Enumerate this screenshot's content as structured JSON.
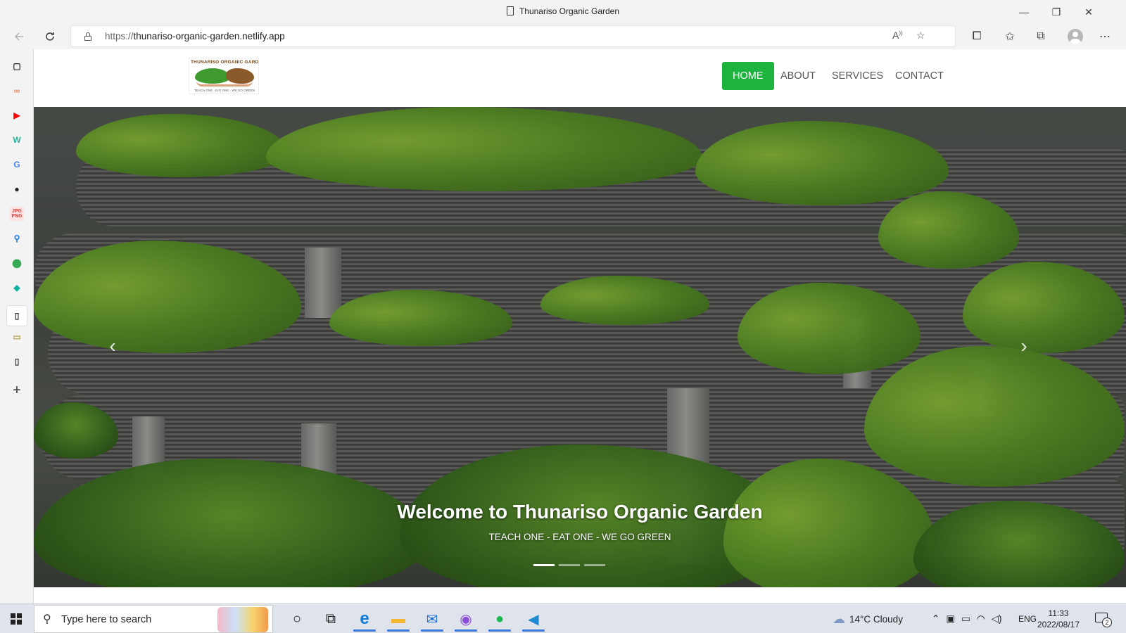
{
  "window": {
    "title": "Thunariso Organic Garden",
    "controls": {
      "minimize": "—",
      "restore": "❐",
      "close": "✕"
    }
  },
  "browser": {
    "url_protocol": "https://",
    "url_host": "thunariso-organic-garden.netlify.app",
    "icons": [
      "back-icon",
      "refresh-icon",
      "lock-icon",
      "read-aloud-icon",
      "add-favorite-icon",
      "extensions-icon",
      "favorites-icon",
      "collections-icon",
      "profile-icon",
      "more-icon"
    ]
  },
  "sidebar": {
    "items": [
      {
        "name": "tabs-icon",
        "glyph": "▢",
        "color": "#222222"
      },
      {
        "name": "copilot-icon",
        "glyph": "∞",
        "color": "#f08a5d"
      },
      {
        "name": "youtube-icon",
        "glyph": "▶",
        "color": "#ff0000"
      },
      {
        "name": "w-app-icon",
        "glyph": "W",
        "color": "#2ab39a"
      },
      {
        "name": "google-icon",
        "glyph": "G",
        "color": "#4285f4"
      },
      {
        "name": "github-icon",
        "glyph": "●",
        "color": "#222222"
      },
      {
        "name": "jpg-png-icon",
        "glyph": "JPG PNG",
        "color": "#e53935"
      },
      {
        "name": "search-icon",
        "glyph": "⚲",
        "color": "#1a73e8"
      },
      {
        "name": "maps-icon",
        "glyph": "⬤",
        "color": "#34a853"
      },
      {
        "name": "diamond-icon",
        "glyph": "◆",
        "color": "#0fb5a3"
      },
      {
        "name": "page-icon",
        "glyph": "▯",
        "color": "#333333"
      },
      {
        "name": "screenshot-icon",
        "glyph": "▭",
        "color": "#b8a64a"
      },
      {
        "name": "document-icon",
        "glyph": "▯",
        "color": "#333333"
      },
      {
        "name": "add-icon",
        "glyph": "+",
        "color": "#333333"
      }
    ]
  },
  "site": {
    "logo": {
      "title": "THUNARISO ORGANIC GARDEN",
      "tagline": "TEACH ONE - EAT ONE - WE GO GREEN"
    },
    "nav": [
      {
        "label": "HOME",
        "active": true
      },
      {
        "label": "ABOUT",
        "active": false
      },
      {
        "label": "SERVICES",
        "active": false
      },
      {
        "label": "CONTACT",
        "active": false
      }
    ],
    "hero": {
      "title": "Welcome to Thunariso Organic Garden",
      "subtitle": "TEACH ONE - EAT ONE - WE GO GREEN",
      "prev_glyph": "‹",
      "next_glyph": "›",
      "slides": 3,
      "active_slide": 1
    },
    "accent_color": "#1db33f"
  },
  "taskbar": {
    "search_placeholder": "Type here to search",
    "apps": [
      {
        "name": "cortana-icon",
        "glyph": "○",
        "color": "#222222",
        "running": false
      },
      {
        "name": "task-view-icon",
        "glyph": "⧉",
        "color": "#222222",
        "running": false
      },
      {
        "name": "edge-icon",
        "glyph": "e",
        "color": "#0f7bd6",
        "running": true
      },
      {
        "name": "file-explorer-icon",
        "glyph": "▬",
        "color": "#f2b632",
        "running": true
      },
      {
        "name": "mail-icon",
        "glyph": "✉",
        "color": "#1d6fd1",
        "running": true
      },
      {
        "name": "chrome-icon",
        "glyph": "◉",
        "color": "#8a4fd6",
        "running": true
      },
      {
        "name": "spotify-icon",
        "glyph": "●",
        "color": "#1db954",
        "running": true
      },
      {
        "name": "vscode-icon",
        "glyph": "◀",
        "color": "#1f8ad2",
        "running": true
      }
    ],
    "weather": "14°C  Cloudy",
    "tray_icons": [
      "chevron-up-icon",
      "meet-now-icon",
      "battery-icon",
      "wifi-icon",
      "volume-icon"
    ],
    "language": "ENG",
    "time": "11:33",
    "date": "2022/08/17",
    "notification_count": "2"
  }
}
